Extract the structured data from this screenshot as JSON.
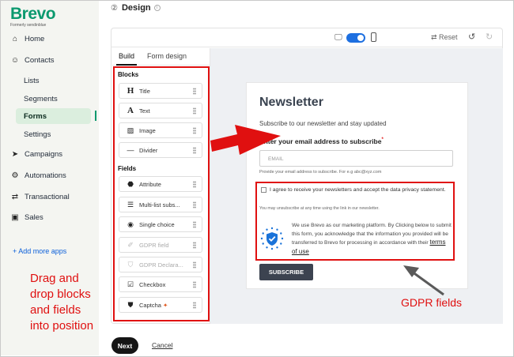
{
  "logo": {
    "name": "Brevo",
    "sub": "Formerly sendinblue"
  },
  "sidebar": {
    "items": [
      {
        "label": "Home",
        "icon": "home-icon",
        "glyph": "⌂"
      },
      {
        "label": "Contacts",
        "icon": "contacts-icon",
        "glyph": "☺"
      }
    ],
    "contacts_sub": [
      "Lists",
      "Segments",
      "Forms",
      "Settings"
    ],
    "items2": [
      {
        "label": "Campaigns",
        "icon": "send-icon",
        "glyph": "➤"
      },
      {
        "label": "Automations",
        "icon": "automation-icon",
        "glyph": "⚙"
      },
      {
        "label": "Transactional",
        "icon": "transactional-icon",
        "glyph": "⇄"
      },
      {
        "label": "Sales",
        "icon": "sales-icon",
        "glyph": "▣"
      }
    ],
    "add_apps": "+ Add more apps"
  },
  "header": {
    "step": "②",
    "title": "Design"
  },
  "toolbar": {
    "reset": "Reset"
  },
  "panel": {
    "tabs": [
      "Build",
      "Form design"
    ],
    "blocks_label": "Blocks",
    "blocks": [
      {
        "label": "Title",
        "glyph": "H"
      },
      {
        "label": "Text",
        "glyph": "A"
      },
      {
        "label": "Image",
        "glyph": "▨"
      },
      {
        "label": "Divider",
        "glyph": "—"
      }
    ],
    "fields_label": "Fields",
    "fields": [
      {
        "label": "Attribute",
        "glyph": "⬣"
      },
      {
        "label": "Multi-list subs...",
        "glyph": "☰"
      },
      {
        "label": "Single choice",
        "glyph": "◉"
      },
      {
        "label": "GDPR field",
        "glyph": "✐"
      },
      {
        "label": "GDPR Declara...",
        "glyph": "⛉"
      },
      {
        "label": "Checkbox",
        "glyph": "☑"
      },
      {
        "label": "Captcha",
        "glyph": "⛊"
      }
    ]
  },
  "form": {
    "title": "Newsletter",
    "subtitle": "Subscribe to our newsletter and stay updated",
    "email_label": "Enter your email address to subscribe",
    "email_placeholder": "EMAIL",
    "email_help": "Provide your email address to subscribe. For e.g abc@xyz.com",
    "gdpr_agree": "I agree to receive your newsletters and accept the data privacy statement.",
    "gdpr_unsub": "You may unsubscribe at any time using the link in our newsletter.",
    "gdpr_text": "We use Brevo as our marketing platform. By Clicking below to submit this form, you acknowledge that the information you provided will be transferred to Brevo for processing in accordance with their",
    "gdpr_link": "terms of use",
    "subscribe": "SUBSCRIBE"
  },
  "annotations": {
    "drag_note": [
      "Drag and",
      "drop blocks",
      "and fields",
      "into position"
    ],
    "gdpr_fields": "GDPR fields",
    "color": "#e01010"
  },
  "footer": {
    "next": "Next",
    "cancel": "Cancel"
  },
  "colors": {
    "brand": "#0b996e",
    "active_bg": "#dbeede",
    "toggle": "#1d6fe0",
    "button_dark": "#3c4350"
  }
}
